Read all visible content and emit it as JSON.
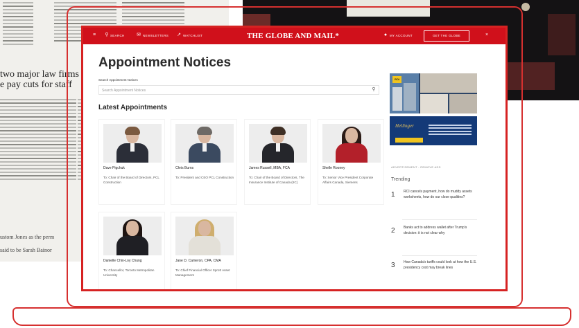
{
  "background": {
    "newspaper_headline_line1": "two major law firms",
    "newspaper_headline_line2": "e pay cuts for staff",
    "newspaper_footer_line1": "ustom Jones as the perm",
    "newspaper_footer_line2": "said to be Sarah Bainor"
  },
  "header": {
    "menu_icon": "menu-icon",
    "search_label": "SEARCH",
    "newsletters_label": "NEWSLETTERS",
    "watchlist_label": "WATCHLIST",
    "logo": "THE GLOBE AND MAIL*",
    "account_label": "MY ACCOUNT",
    "subscribe_label": "GET THE GLOBE",
    "close_icon": "close-icon",
    "brand_color": "#d0101b"
  },
  "main": {
    "title": "Appointment Notices",
    "search_label": "Search Appointment Notices",
    "search_placeholder": "Search Appointment Notices",
    "section_title": "Latest Appointments"
  },
  "appointments": [
    {
      "name": "Dave Pigchuk",
      "role": "To: Chair of the Board of Directors, PCL Construction"
    },
    {
      "name": "Chris Burns",
      "role": "To: President and CEO PCL Construction"
    },
    {
      "name": "James Russell, MBA, FCA",
      "role": "To: Chair of the Board of Directors, The Insurance Institute of Canada (IIC)"
    },
    {
      "name": "Shelle Rooney",
      "role": "To: Senior Vice President Corporate Affairs Canada, Siemens"
    },
    {
      "name": "Danielle Chin-Loy Chung",
      "role": "To: Chancellor, Toronto Metropolitan University"
    },
    {
      "name": "Jane D. Cameron, CPA, CMA",
      "role": "To: Chief Financial Officer Sprott Asset Management"
    }
  ],
  "sidebar": {
    "ad1_badge": "ROI",
    "ad2_brand": "Hellinger",
    "advertisement_label": "ADVERTISEMENT - REMOVE ADS",
    "trending_title": "Trending",
    "trending": [
      {
        "rank": "1",
        "headline": "RCI cancels payment, how do muddy assets worksheets, how do our close qualities?"
      },
      {
        "rank": "2",
        "headline": "Banks act to address wallet after Trump's decision: it is not clear why"
      },
      {
        "rank": "3",
        "headline": "How Canada's tariffs could look at how the U.S. presidency cost may break lines"
      }
    ]
  }
}
